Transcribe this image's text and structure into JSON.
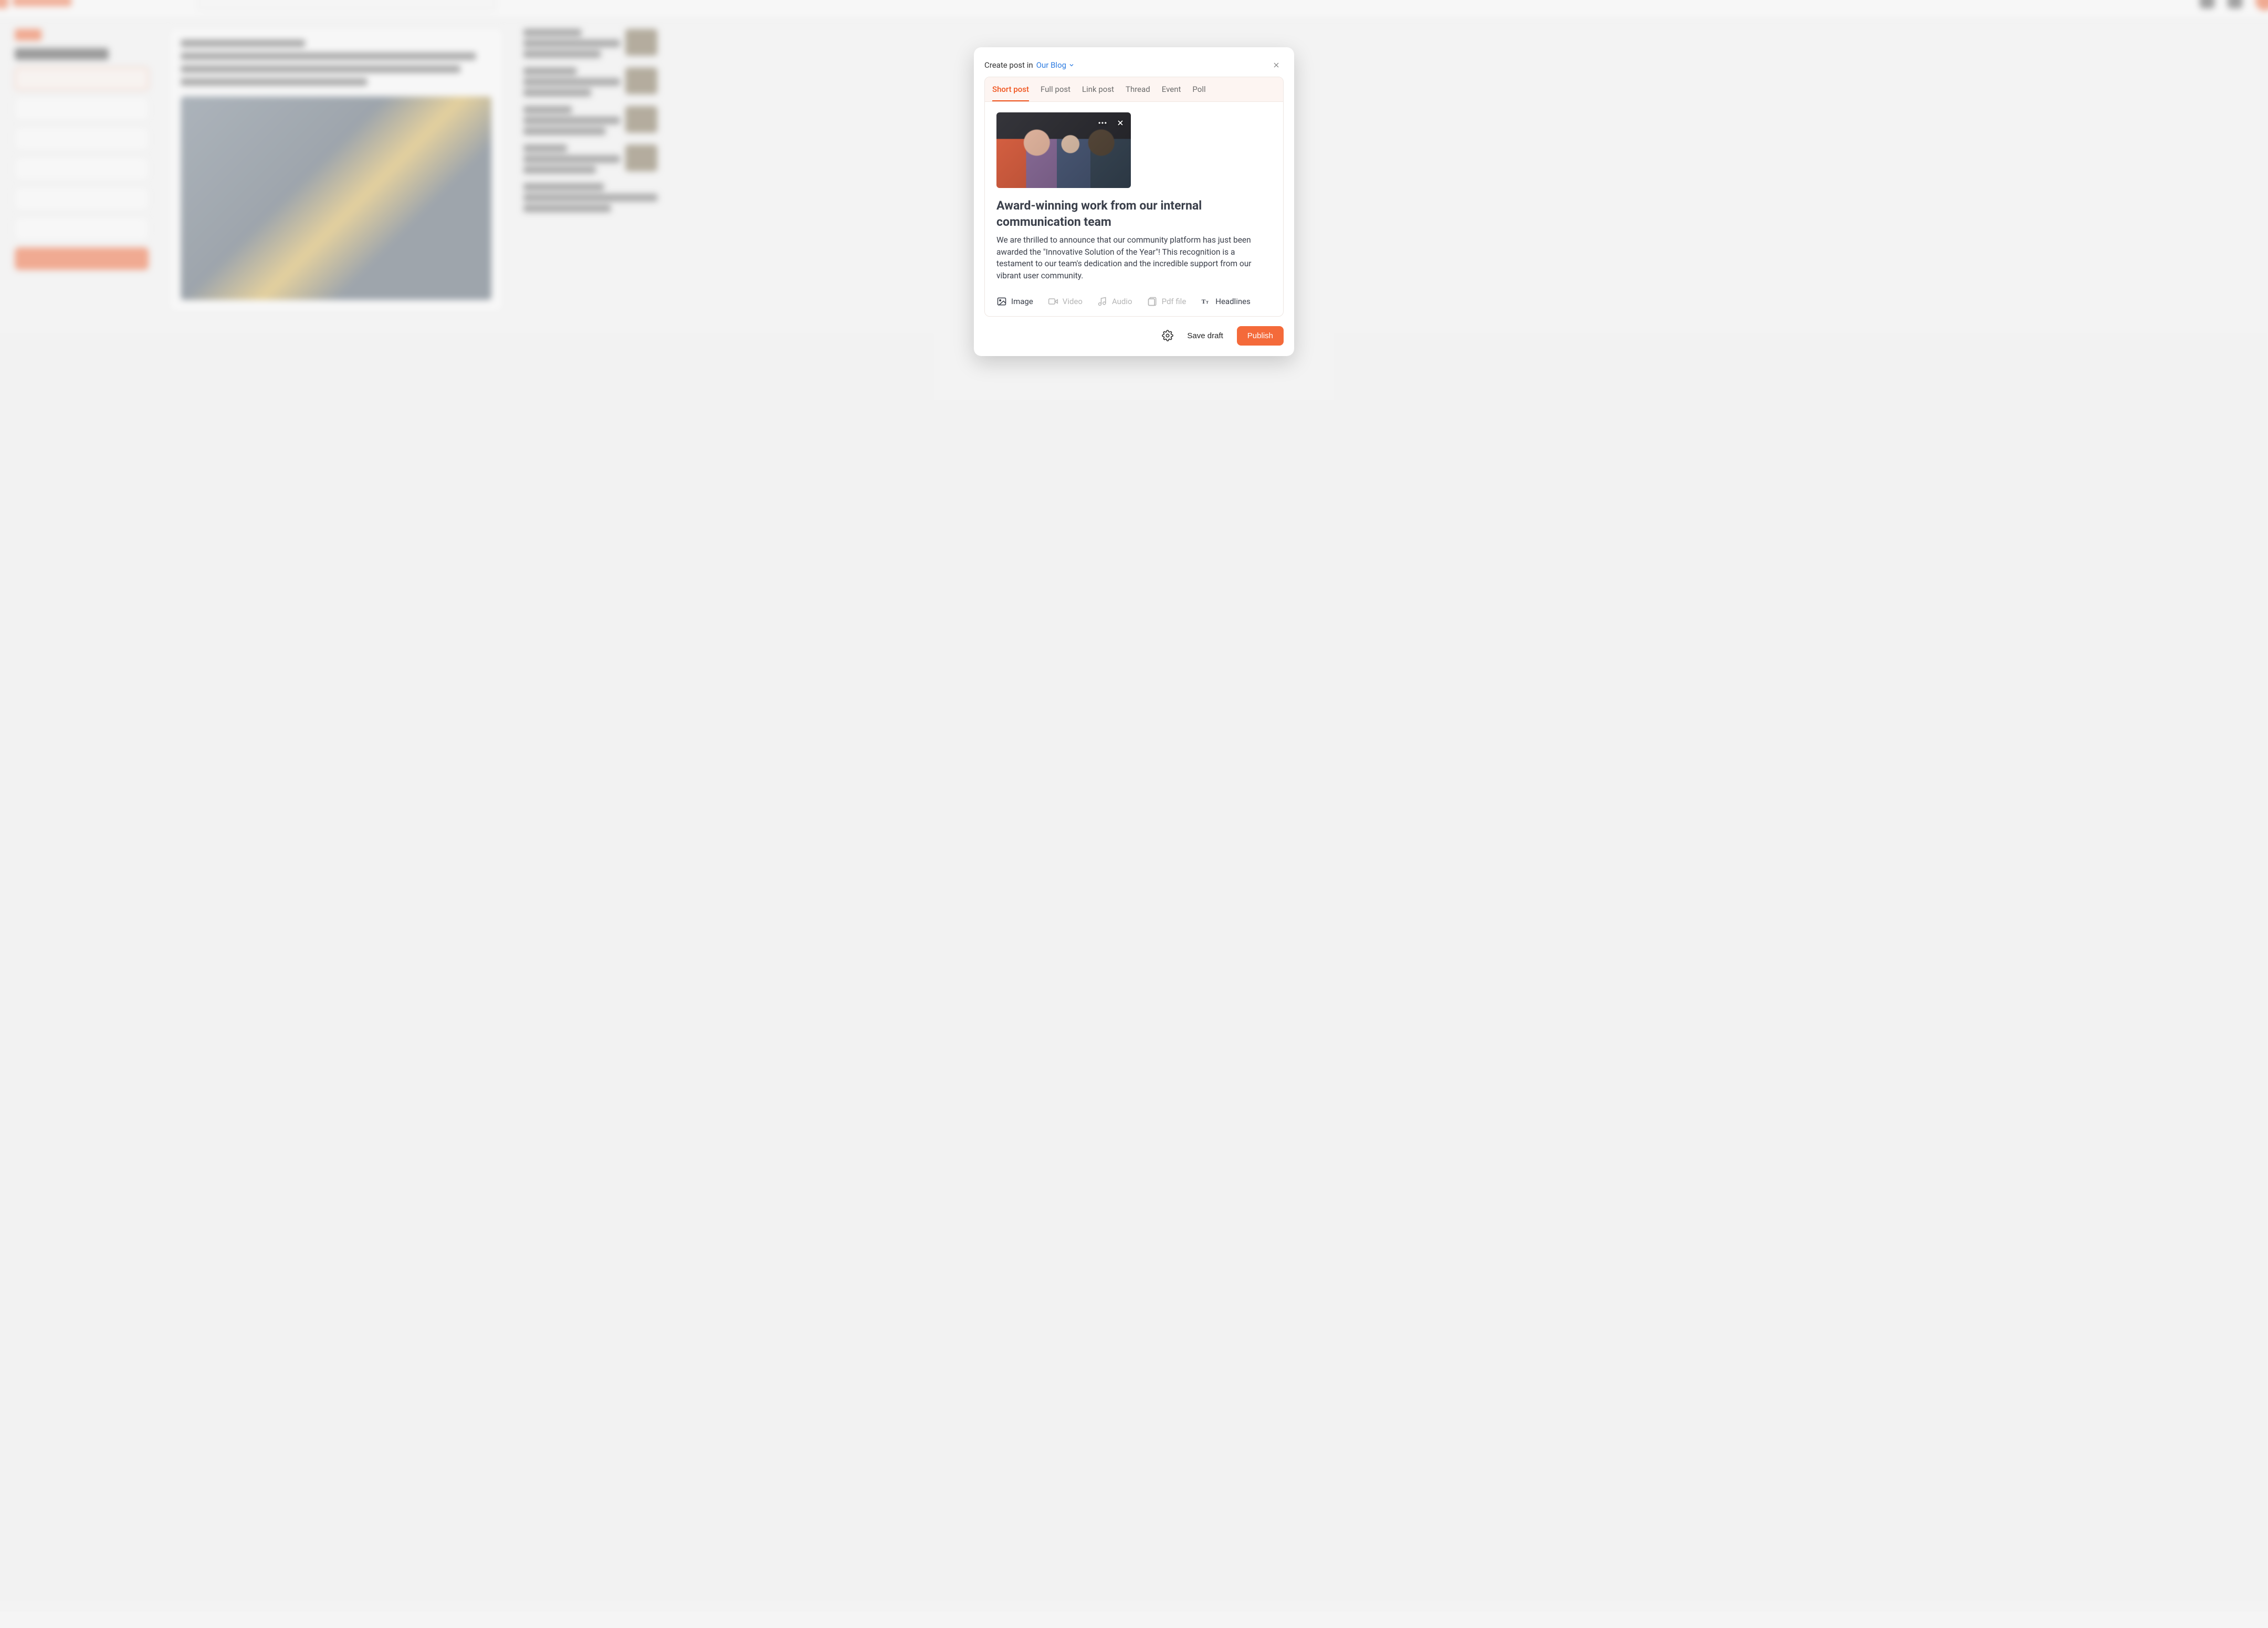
{
  "modal": {
    "header": {
      "prefix": "Create post in",
      "blog_name": "Our Blog"
    },
    "tabs": [
      {
        "id": "short",
        "label": "Short post",
        "active": true
      },
      {
        "id": "full",
        "label": "Full post",
        "active": false
      },
      {
        "id": "link",
        "label": "Link post",
        "active": false
      },
      {
        "id": "thread",
        "label": "Thread",
        "active": false
      },
      {
        "id": "event",
        "label": "Event",
        "active": false
      },
      {
        "id": "poll",
        "label": "Poll",
        "active": false
      }
    ],
    "post": {
      "image_alt": "Team high-fiving",
      "title": "Award-winning work from our internal communication team",
      "body": "We are thrilled to announce that our community platform has just been awarded the \"Innovative Solution of the Year\"! This recognition is a testament to our team's dedication and the incredible support from our vibrant user community."
    },
    "attachments": [
      {
        "id": "image",
        "label": "Image",
        "icon": "image-icon",
        "enabled": true
      },
      {
        "id": "video",
        "label": "Video",
        "icon": "video-icon",
        "enabled": false
      },
      {
        "id": "audio",
        "label": "Audio",
        "icon": "audio-icon",
        "enabled": false
      },
      {
        "id": "pdf",
        "label": "Pdf file",
        "icon": "pdf-icon",
        "enabled": false
      },
      {
        "id": "headlines",
        "label": "Headlines",
        "icon": "headlines-icon",
        "enabled": true
      }
    ],
    "footer": {
      "save_draft": "Save draft",
      "publish": "Publish"
    }
  },
  "colors": {
    "accent": "#f0551f",
    "link": "#2f7de1"
  }
}
